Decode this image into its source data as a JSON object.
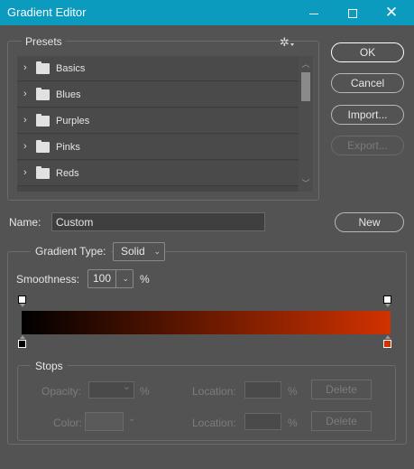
{
  "window": {
    "title": "Gradient Editor",
    "controls": {
      "minimize": "minimize-icon",
      "maximize": "maximize-icon",
      "close": "close-icon"
    }
  },
  "presets": {
    "label": "Presets",
    "settings_icon": "gear-icon",
    "items": [
      {
        "label": "Basics",
        "icon": "folder-icon"
      },
      {
        "label": "Blues",
        "icon": "folder-icon"
      },
      {
        "label": "Purples",
        "icon": "folder-icon"
      },
      {
        "label": "Pinks",
        "icon": "folder-icon"
      },
      {
        "label": "Reds",
        "icon": "folder-icon"
      }
    ]
  },
  "buttons": {
    "ok": "OK",
    "cancel": "Cancel",
    "import": "Import...",
    "export": "Export...",
    "new": "New"
  },
  "name": {
    "label": "Name:",
    "value": "Custom"
  },
  "gradient": {
    "type_label": "Gradient Type:",
    "type_value": "Solid",
    "smoothness_label": "Smoothness:",
    "smoothness_value": "100",
    "smoothness_unit": "%",
    "start_color": "#000000",
    "end_color": "#d13200"
  },
  "stops": {
    "label": "Stops",
    "opacity_label": "Opacity:",
    "opacity_unit": "%",
    "color_label": "Color:",
    "location_label": "Location:",
    "location_unit": "%",
    "delete_label": "Delete"
  }
}
